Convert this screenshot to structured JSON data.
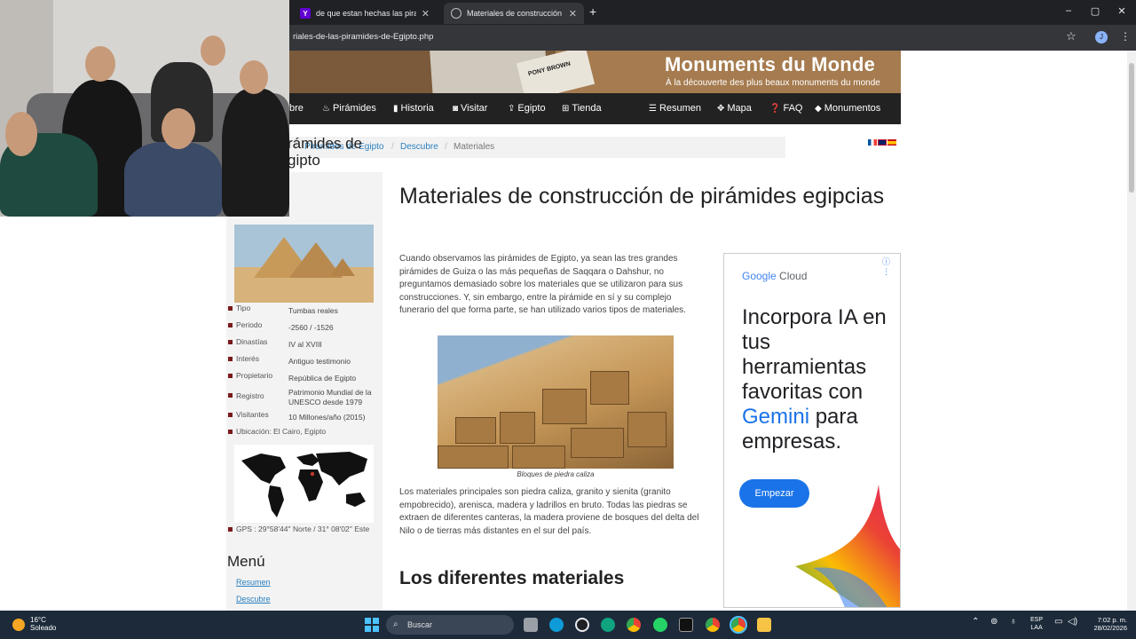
{
  "browser": {
    "tabs": [
      {
        "title": "de que estan hechas las piramides",
        "favicon": "Y",
        "favicon_color": "#6001d2"
      },
      {
        "title": "Materiales de construcción de pirámides",
        "favicon": "globe-icon"
      }
    ],
    "url": "riales-de-las-piramides-de-Egipto.php",
    "profile_initial": "J"
  },
  "site": {
    "brand": "Monuments du Monde",
    "tagline": "À la découverte des plus beaux monuments du monde",
    "photo_label": "PONY BROWN",
    "nav": [
      {
        "label": "bre",
        "icon": ""
      },
      {
        "label": "Pirámides",
        "icon": "fire-icon"
      },
      {
        "label": "Historia",
        "icon": "book-icon"
      },
      {
        "label": "Visitar",
        "icon": "camera-icon"
      },
      {
        "label": "Egipto",
        "icon": "upload-icon"
      },
      {
        "label": "Tienda",
        "icon": "cart-icon"
      },
      {
        "label": "Resumen",
        "icon": "list-icon"
      },
      {
        "label": "Mapa",
        "icon": "compass-icon"
      },
      {
        "label": "FAQ",
        "icon": "question-icon"
      },
      {
        "label": "Monumentos",
        "icon": "tag-icon"
      }
    ],
    "breadcrumb": [
      "Pirámides de Egipto",
      "Descubre",
      "Materiales"
    ]
  },
  "sidebar": {
    "title": "rámides de gipto",
    "info": [
      {
        "label": "Tipo",
        "value": "Tumbas reales"
      },
      {
        "label": "Periodo",
        "value": "-2560 / -1526"
      },
      {
        "label": "Dinastías",
        "value": "IV al XVIII"
      },
      {
        "label": "Interés",
        "value": "Antiguo testimonio"
      },
      {
        "label": "Propietario",
        "value": "República de Egipto"
      },
      {
        "label": "Registro",
        "value": "Patrimonio Mundial de la UNESCO desde 1979"
      },
      {
        "label": "Visitantes",
        "value": "10 Millones/año (2015)"
      }
    ],
    "location": "Ubicación: El Cairo, Egipto",
    "gps": "GPS : 29°58'44'' Norte / 31° 08'02'' Este",
    "menu_title": "Menú",
    "menu_links": [
      "Resumen",
      "Descubre"
    ]
  },
  "article": {
    "title": "Materiales de construcción de pirámides egipcias",
    "intro": "Cuando observamos las pirámides de Egipto, ya sean las tres grandes pirámides de Guiza o las más pequeñas de Saqqara o Dahshur, no preguntamos demasiado sobre los materiales que se utilizaron para sus construcciones. Y, sin embargo, entre la pirámide en sí y su complejo funerario del que forma parte, se han utilizado varios tipos de materiales.",
    "image_caption": "Bloques de piedra caliza",
    "para2": "Los materiales principales son piedra caliza, granito y sienita (granito empobrecido), arenisca, madera y ladrillos en bruto. Todas las piedras se extraen de diferentes canteras, la madera proviene de bosques del delta del Nilo o de tierras más distantes en el sur del país.",
    "subtitle": "Los diferentes materiales"
  },
  "ad": {
    "brand_google": "Google",
    "brand_cloud": "Cloud",
    "headline_a": "Incorpora IA en tus herramientas favoritas con ",
    "headline_gemini": "Gemini",
    "headline_b": " para empresas.",
    "cta": "Empezar"
  },
  "taskbar": {
    "temp": "16°C",
    "weather": "Soleado",
    "search": "Buscar",
    "lang1": "ESP",
    "lang2": "LAA",
    "time": "7:02 p. m.",
    "date": "28/02/2026"
  }
}
